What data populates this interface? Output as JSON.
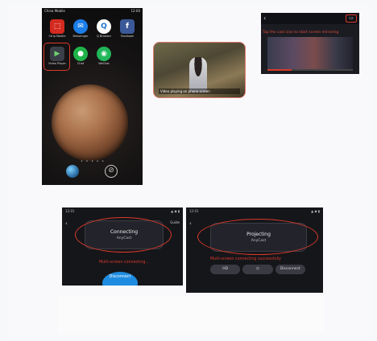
{
  "phone": {
    "status_left": "China Mobile",
    "status_right": "12:00",
    "apps": [
      {
        "label": "Ctrip Mobile",
        "icon": "ctrip-icon",
        "color": "#d42a1f",
        "glyph": "⬚"
      },
      {
        "label": "Messenger",
        "icon": "messenger-icon",
        "color": "#1c7ee8",
        "glyph": "✉"
      },
      {
        "label": "Q Browser",
        "icon": "q-browser-icon",
        "color": "#1a6fd0",
        "glyph": "Q"
      },
      {
        "label": "Facebook",
        "icon": "facebook-icon",
        "color": "#3b5998",
        "glyph": "f"
      },
      {
        "label": "Video Player",
        "icon": "play-icon",
        "color": "#2b2f36",
        "glyph": "▶",
        "highlighted": true
      },
      {
        "label": "Chat",
        "icon": "chat-icon",
        "color": "#1fb34a",
        "glyph": "●"
      },
      {
        "label": "WeChat",
        "icon": "wechat-icon",
        "color": "#20b85a",
        "glyph": "◉"
      }
    ],
    "page_dots": "• • • • •"
  },
  "video_thumb": {
    "caption": "Video playing on phone screen"
  },
  "player": {
    "back": "‹",
    "cast_glyph": "▭",
    "red_label": "Tap the cast icon to start screen mirroring",
    "progress": 0.28
  },
  "connect_screen": {
    "status_left": "12:01",
    "status_right": "▲ ◆ ▮",
    "back": "‹",
    "right_text": "Guide",
    "pill_title": "Connecting",
    "pill_sub": "AnyCast",
    "red_note": "Multi-screen connecting...",
    "cancel_label": "Disconnect"
  },
  "project_screen": {
    "status_left": "12:01",
    "status_right": "▲ ◆ ▮",
    "back": "‹",
    "pill_title": "Projecting",
    "pill_sub": "AnyCast",
    "red_note": "Multi-screen connecting successfully",
    "buttons": [
      "HD",
      "◷",
      "Disconnect"
    ]
  }
}
